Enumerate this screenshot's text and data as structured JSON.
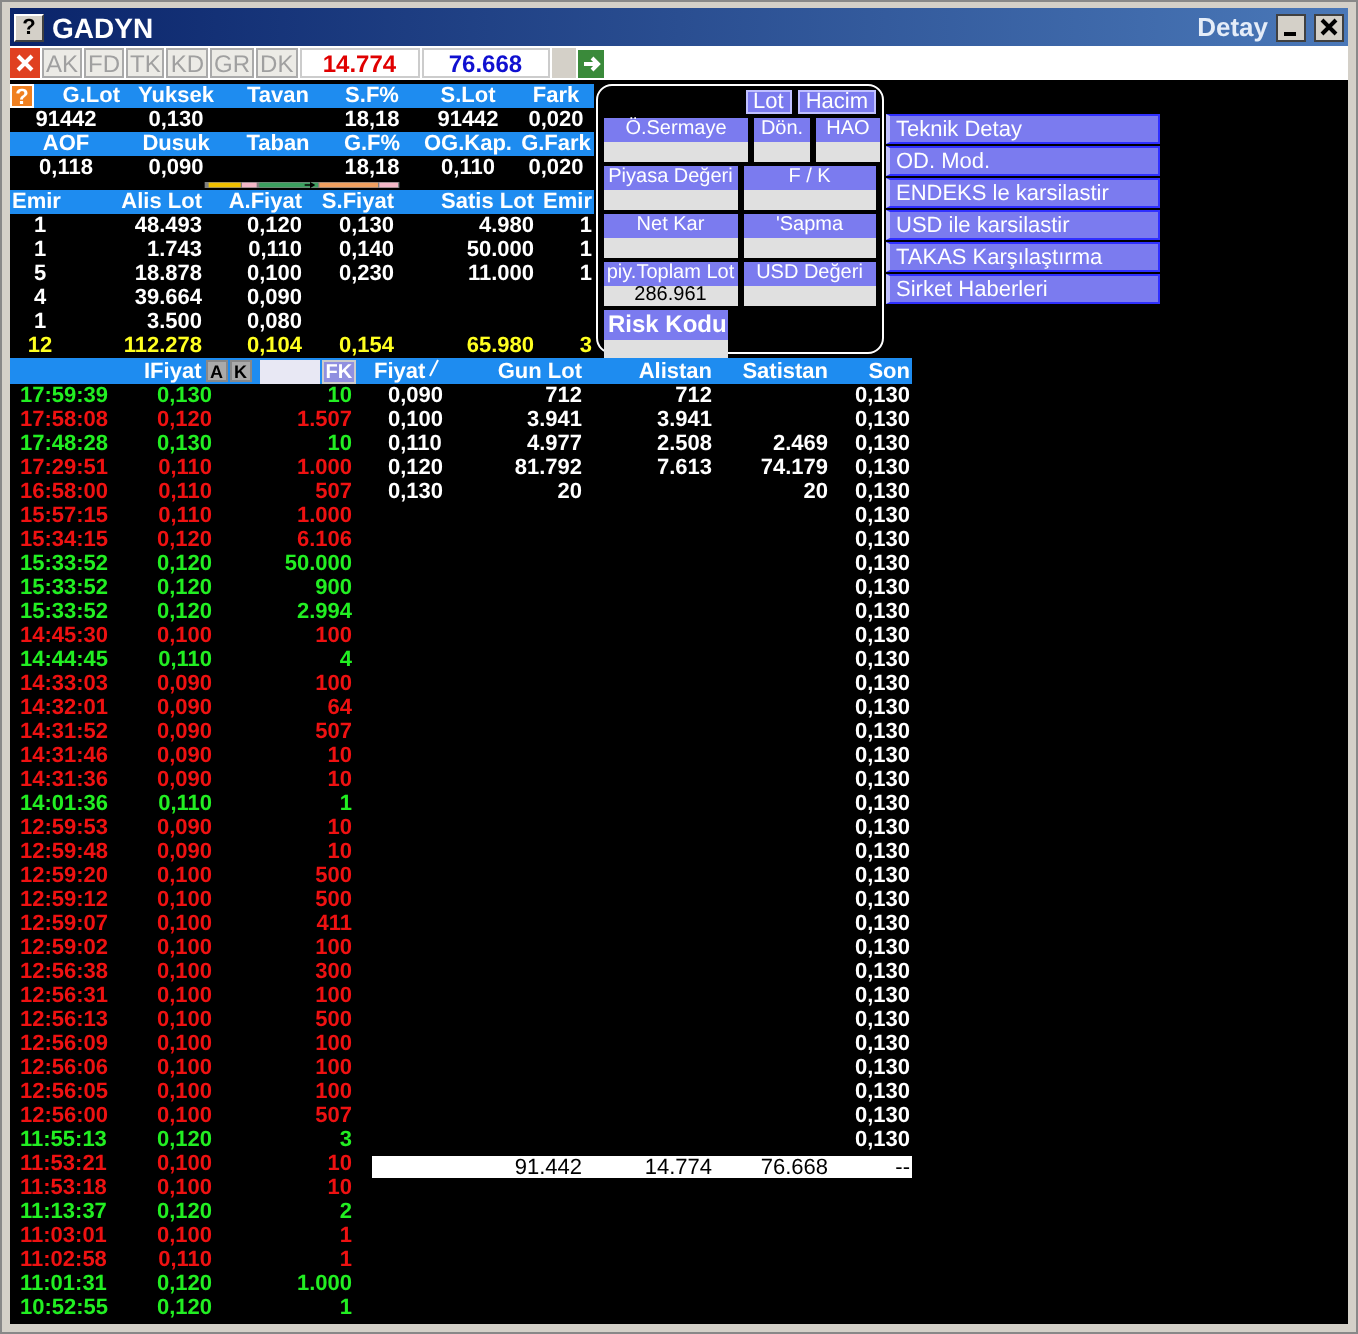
{
  "window": {
    "icon_glyph": "?",
    "title": "GADYN",
    "caption_right": "Detay"
  },
  "toolbar": {
    "tabs": [
      {
        "label": "AK",
        "disabled": true
      },
      {
        "label": "FD",
        "disabled": true
      },
      {
        "label": "TK",
        "disabled": true
      },
      {
        "label": "KD",
        "disabled": true
      },
      {
        "label": "GR",
        "disabled": true
      },
      {
        "label": "DK",
        "disabled": true
      }
    ],
    "value_red": "14.774",
    "value_blue": "76.668"
  },
  "summary": {
    "help_glyph": "?",
    "header_1": [
      "G.Lot",
      "Yuksek",
      "Tavan",
      "S.F%",
      "S.Lot",
      "Fark"
    ],
    "values_1": {
      "g_lot": "91442",
      "yuksek": "0,130",
      "s_f": "18,18",
      "s_lot": "91442",
      "fark": "0,020"
    },
    "header_2": [
      "AOF",
      "Dusuk",
      "Taban",
      "G.F%",
      "OG.Kap.",
      "G.Fark"
    ],
    "values_2": {
      "aof": "0,118",
      "dusuk": "0,090",
      "g_f": "18,18",
      "og_kap": "0,110",
      "g_fark": "0,020"
    }
  },
  "order_book": {
    "columns": [
      "Emir",
      "Alis Lot",
      "A.Fiyat",
      "S.Fiyat",
      "Satis Lot",
      "Emir"
    ],
    "rows": [
      [
        "1",
        "48.493",
        "0,120",
        "0,130",
        "4.980",
        "1"
      ],
      [
        "1",
        "1.743",
        "0,110",
        "0,140",
        "50.000",
        "1"
      ],
      [
        "5",
        "18.878",
        "0,100",
        "0,230",
        "11.000",
        "1"
      ],
      [
        "4",
        "39.664",
        "0,090",
        null,
        null,
        null
      ],
      [
        "1",
        "3.500",
        "0,080",
        null,
        null,
        null
      ]
    ],
    "totals": [
      "12",
      "112.278",
      "0,104",
      "0,154",
      "65.980",
      "3"
    ]
  },
  "info_panel": {
    "toggles": [
      {
        "label": "Lot"
      },
      {
        "label": "Hacim"
      }
    ],
    "field_rows": [
      [
        {
          "label": "Ö.Sermaye"
        },
        {
          "label": "Dön."
        },
        {
          "label": "HAO"
        }
      ],
      [
        {
          "label": "Piyasa Değeri"
        },
        {
          "label": "F / K"
        }
      ],
      [
        {
          "label": "Net Kar"
        },
        {
          "label": "'Sapma"
        }
      ],
      [
        {
          "label": "piy.Toplam Lot",
          "value": "286.961"
        },
        {
          "label": "USD Değeri"
        }
      ]
    ],
    "risk_label": "Risk Kodu"
  },
  "menu_buttons": [
    "Teknik Detay",
    "OD. Mod.",
    "ENDEKS le karsilastir",
    "USD ile karsilastir",
    "TAKAS Karşılaştırma",
    "Sirket Haberleri"
  ],
  "ticks": {
    "header": "IFiyat",
    "filter_buttons": [
      "A",
      "K"
    ],
    "fk_button": "FK",
    "rows": [
      {
        "time": "17:59:39",
        "price": "0,130",
        "lot": "10",
        "color": "#22ee22"
      },
      {
        "time": "17:58:08",
        "price": "0,120",
        "lot": "1.507",
        "color": "#ee1111"
      },
      {
        "time": "17:48:28",
        "price": "0,130",
        "lot": "10",
        "color": "#22ee22"
      },
      {
        "time": "17:29:51",
        "price": "0,110",
        "lot": "1.000",
        "color": "#ee1111"
      },
      {
        "time": "16:58:00",
        "price": "0,110",
        "lot": "507",
        "color": "#ee1111"
      },
      {
        "time": "15:57:15",
        "price": "0,110",
        "lot": "1.000",
        "color": "#ee1111"
      },
      {
        "time": "15:34:15",
        "price": "0,120",
        "lot": "6.106",
        "color": "#ee1111"
      },
      {
        "time": "15:33:52",
        "price": "0,120",
        "lot": "50.000",
        "color": "#22ee22"
      },
      {
        "time": "15:33:52",
        "price": "0,120",
        "lot": "900",
        "color": "#22ee22"
      },
      {
        "time": "15:33:52",
        "price": "0,120",
        "lot": "2.994",
        "color": "#22ee22"
      },
      {
        "time": "14:45:30",
        "price": "0,100",
        "lot": "100",
        "color": "#ee1111"
      },
      {
        "time": "14:44:45",
        "price": "0,110",
        "lot": "4",
        "color": "#22ee22"
      },
      {
        "time": "14:33:03",
        "price": "0,090",
        "lot": "100",
        "color": "#ee1111"
      },
      {
        "time": "14:32:01",
        "price": "0,090",
        "lot": "64",
        "color": "#ee1111"
      },
      {
        "time": "14:31:52",
        "price": "0,090",
        "lot": "507",
        "color": "#ee1111"
      },
      {
        "time": "14:31:46",
        "price": "0,090",
        "lot": "10",
        "color": "#ee1111"
      },
      {
        "time": "14:31:36",
        "price": "0,090",
        "lot": "10",
        "color": "#ee1111"
      },
      {
        "time": "14:01:36",
        "price": "0,110",
        "lot": "1",
        "color": "#22ee22"
      },
      {
        "time": "12:59:53",
        "price": "0,090",
        "lot": "10",
        "color": "#ee1111"
      },
      {
        "time": "12:59:48",
        "price": "0,090",
        "lot": "10",
        "color": "#ee1111"
      },
      {
        "time": "12:59:20",
        "price": "0,100",
        "lot": "500",
        "color": "#ee1111"
      },
      {
        "time": "12:59:12",
        "price": "0,100",
        "lot": "500",
        "color": "#ee1111"
      },
      {
        "time": "12:59:07",
        "price": "0,100",
        "lot": "411",
        "color": "#ee1111"
      },
      {
        "time": "12:59:02",
        "price": "0,100",
        "lot": "100",
        "color": "#ee1111"
      },
      {
        "time": "12:56:38",
        "price": "0,100",
        "lot": "300",
        "color": "#ee1111"
      },
      {
        "time": "12:56:31",
        "price": "0,100",
        "lot": "100",
        "color": "#ee1111"
      },
      {
        "time": "12:56:13",
        "price": "0,100",
        "lot": "500",
        "color": "#ee1111"
      },
      {
        "time": "12:56:09",
        "price": "0,100",
        "lot": "100",
        "color": "#ee1111"
      },
      {
        "time": "12:56:06",
        "price": "0,100",
        "lot": "100",
        "color": "#ee1111"
      },
      {
        "time": "12:56:05",
        "price": "0,100",
        "lot": "100",
        "color": "#ee1111"
      },
      {
        "time": "12:56:00",
        "price": "0,100",
        "lot": "507",
        "color": "#ee1111"
      },
      {
        "time": "11:55:13",
        "price": "0,120",
        "lot": "3",
        "color": "#22ee22"
      },
      {
        "time": "11:53:21",
        "price": "0,100",
        "lot": "10",
        "color": "#ee1111"
      },
      {
        "time": "11:53:18",
        "price": "0,100",
        "lot": "10",
        "color": "#ee1111"
      },
      {
        "time": "11:13:37",
        "price": "0,120",
        "lot": "2",
        "color": "#22ee22"
      },
      {
        "time": "11:03:01",
        "price": "0,100",
        "lot": "1",
        "color": "#ee1111"
      },
      {
        "time": "11:02:58",
        "price": "0,110",
        "lot": "1",
        "color": "#ee1111"
      },
      {
        "time": "11:01:31",
        "price": "0,120",
        "lot": "1.000",
        "color": "#22ee22"
      },
      {
        "time": "10:52:55",
        "price": "0,120",
        "lot": "1",
        "color": "#22ee22"
      }
    ]
  },
  "price_table": {
    "columns": [
      "Fiyat",
      "Gun Lot",
      "Alistan",
      "Satistan",
      "Son"
    ],
    "rows": [
      {
        "fiyat": "0,090",
        "gun_lot": "712",
        "alistan": "712",
        "son": "0,130"
      },
      {
        "fiyat": "0,100",
        "gun_lot": "3.941",
        "alistan": "3.941",
        "son": "0,130"
      },
      {
        "fiyat": "0,110",
        "gun_lot": "4.977",
        "alistan": "2.508",
        "satistan": "2.469",
        "son": "0,130"
      },
      {
        "fiyat": "0,120",
        "gun_lot": "81.792",
        "alistan": "7.613",
        "satistan": "74.179",
        "son": "0,130"
      },
      {
        "fiyat": "0,130",
        "gun_lot": "20",
        "satistan": "20",
        "son": "0,130"
      },
      {
        "son": "0,130"
      },
      {
        "son": "0,130"
      },
      {
        "son": "0,130"
      },
      {
        "son": "0,130"
      },
      {
        "son": "0,130"
      },
      {
        "son": "0,130"
      },
      {
        "son": "0,130"
      },
      {
        "son": "0,130"
      },
      {
        "son": "0,130"
      },
      {
        "son": "0,130"
      },
      {
        "son": "0,130"
      },
      {
        "son": "0,130"
      },
      {
        "son": "0,130"
      },
      {
        "son": "0,130"
      },
      {
        "son": "0,130"
      },
      {
        "son": "0,130"
      },
      {
        "son": "0,130"
      },
      {
        "son": "0,130"
      },
      {
        "son": "0,130"
      },
      {
        "son": "0,130"
      },
      {
        "son": "0,130"
      },
      {
        "son": "0,130"
      },
      {
        "son": "0,130"
      },
      {
        "son": "0,130"
      },
      {
        "son": "0,130"
      },
      {
        "son": "0,130"
      },
      {
        "son": "0,130"
      }
    ],
    "totals": {
      "gun_lot": "91.442",
      "alistan": "14.774",
      "satistan": "76.668",
      "son": "--"
    }
  }
}
